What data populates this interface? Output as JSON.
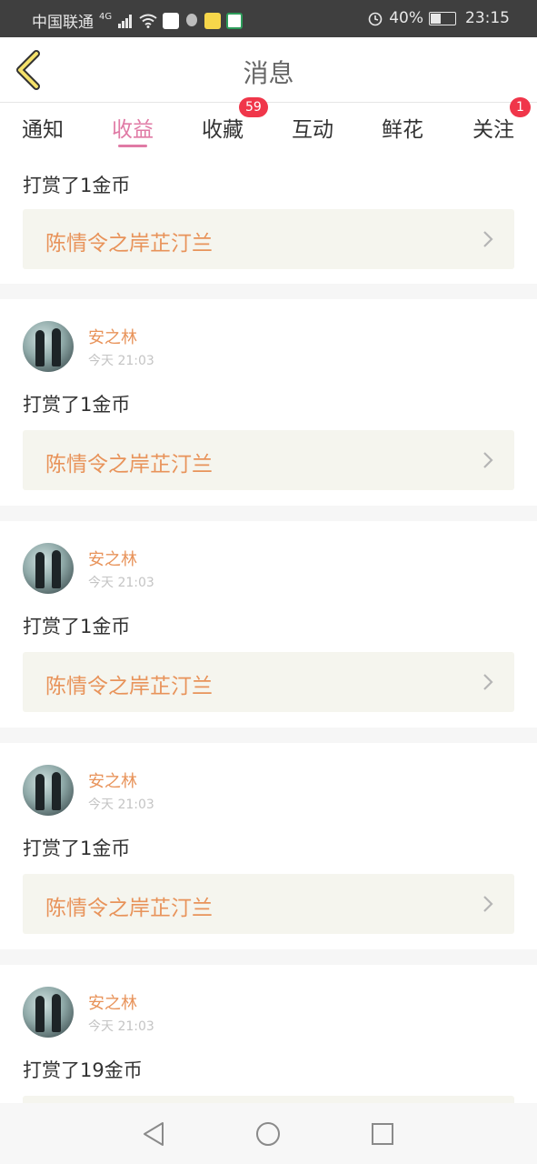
{
  "status_bar": {
    "carrier": "中国联通",
    "network": "4G",
    "battery": "40%",
    "time": "23:15",
    "icons": [
      "signal-icon",
      "wifi-icon",
      "app-notification-icon",
      "qq-icon",
      "wechat-icon",
      "app-icon",
      "alarm-icon",
      "battery-icon"
    ]
  },
  "header": {
    "title": "消息",
    "back_icon": "chevron-left-icon"
  },
  "tabs": [
    {
      "label": "通知",
      "active": false
    },
    {
      "label": "收益",
      "active": true
    },
    {
      "label": "收藏",
      "active": false,
      "badge": "59"
    },
    {
      "label": "互动",
      "active": false
    },
    {
      "label": "鲜花",
      "active": false
    },
    {
      "label": "关注",
      "active": false,
      "badge": "1"
    }
  ],
  "colors": {
    "accent_pink": "#e07aa5",
    "name_orange": "#e8935a",
    "badge_red": "#f0364a",
    "book_bg": "#f5f5ee"
  },
  "messages": [
    {
      "reward": "打赏了1金币",
      "book": "陈情令之岸芷汀兰"
    },
    {
      "user": "安之林",
      "time": "今天 21:03",
      "reward": "打赏了1金币",
      "book": "陈情令之岸芷汀兰"
    },
    {
      "user": "安之林",
      "time": "今天 21:03",
      "reward": "打赏了1金币",
      "book": "陈情令之岸芷汀兰"
    },
    {
      "user": "安之林",
      "time": "今天 21:03",
      "reward": "打赏了1金币",
      "book": "陈情令之岸芷汀兰"
    },
    {
      "user": "安之林",
      "time": "今天 21:03",
      "reward": "打赏了19金币",
      "book": ""
    }
  ],
  "nav": [
    "back-triangle-icon",
    "home-circle-icon",
    "recents-square-icon"
  ]
}
